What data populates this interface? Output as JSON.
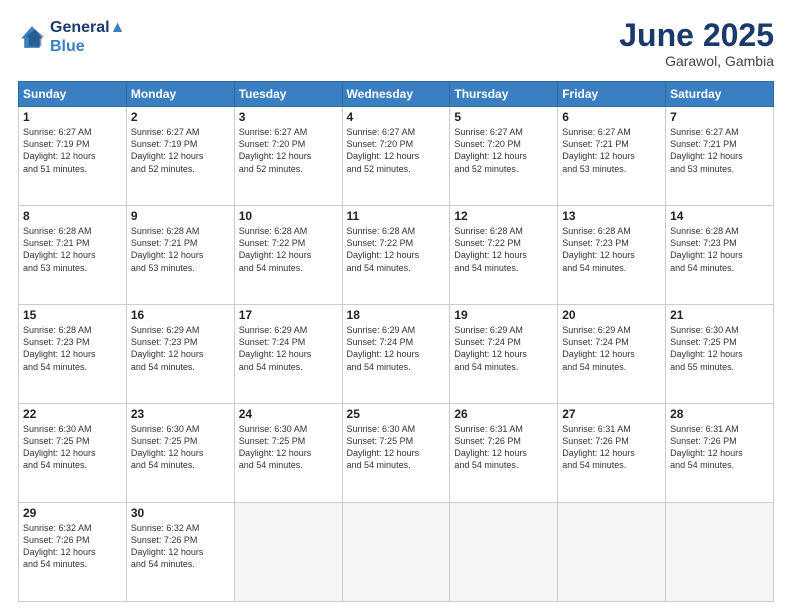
{
  "logo": {
    "line1": "General",
    "line2": "Blue"
  },
  "title": "June 2025",
  "location": "Garawol, Gambia",
  "weekdays": [
    "Sunday",
    "Monday",
    "Tuesday",
    "Wednesday",
    "Thursday",
    "Friday",
    "Saturday"
  ],
  "weeks": [
    [
      {
        "day": "1",
        "detail": "Sunrise: 6:27 AM\nSunset: 7:19 PM\nDaylight: 12 hours\nand 51 minutes."
      },
      {
        "day": "2",
        "detail": "Sunrise: 6:27 AM\nSunset: 7:19 PM\nDaylight: 12 hours\nand 52 minutes."
      },
      {
        "day": "3",
        "detail": "Sunrise: 6:27 AM\nSunset: 7:20 PM\nDaylight: 12 hours\nand 52 minutes."
      },
      {
        "day": "4",
        "detail": "Sunrise: 6:27 AM\nSunset: 7:20 PM\nDaylight: 12 hours\nand 52 minutes."
      },
      {
        "day": "5",
        "detail": "Sunrise: 6:27 AM\nSunset: 7:20 PM\nDaylight: 12 hours\nand 52 minutes."
      },
      {
        "day": "6",
        "detail": "Sunrise: 6:27 AM\nSunset: 7:21 PM\nDaylight: 12 hours\nand 53 minutes."
      },
      {
        "day": "7",
        "detail": "Sunrise: 6:27 AM\nSunset: 7:21 PM\nDaylight: 12 hours\nand 53 minutes."
      }
    ],
    [
      {
        "day": "8",
        "detail": "Sunrise: 6:28 AM\nSunset: 7:21 PM\nDaylight: 12 hours\nand 53 minutes."
      },
      {
        "day": "9",
        "detail": "Sunrise: 6:28 AM\nSunset: 7:21 PM\nDaylight: 12 hours\nand 53 minutes."
      },
      {
        "day": "10",
        "detail": "Sunrise: 6:28 AM\nSunset: 7:22 PM\nDaylight: 12 hours\nand 54 minutes."
      },
      {
        "day": "11",
        "detail": "Sunrise: 6:28 AM\nSunset: 7:22 PM\nDaylight: 12 hours\nand 54 minutes."
      },
      {
        "day": "12",
        "detail": "Sunrise: 6:28 AM\nSunset: 7:22 PM\nDaylight: 12 hours\nand 54 minutes."
      },
      {
        "day": "13",
        "detail": "Sunrise: 6:28 AM\nSunset: 7:23 PM\nDaylight: 12 hours\nand 54 minutes."
      },
      {
        "day": "14",
        "detail": "Sunrise: 6:28 AM\nSunset: 7:23 PM\nDaylight: 12 hours\nand 54 minutes."
      }
    ],
    [
      {
        "day": "15",
        "detail": "Sunrise: 6:28 AM\nSunset: 7:23 PM\nDaylight: 12 hours\nand 54 minutes."
      },
      {
        "day": "16",
        "detail": "Sunrise: 6:29 AM\nSunset: 7:23 PM\nDaylight: 12 hours\nand 54 minutes."
      },
      {
        "day": "17",
        "detail": "Sunrise: 6:29 AM\nSunset: 7:24 PM\nDaylight: 12 hours\nand 54 minutes."
      },
      {
        "day": "18",
        "detail": "Sunrise: 6:29 AM\nSunset: 7:24 PM\nDaylight: 12 hours\nand 54 minutes."
      },
      {
        "day": "19",
        "detail": "Sunrise: 6:29 AM\nSunset: 7:24 PM\nDaylight: 12 hours\nand 54 minutes."
      },
      {
        "day": "20",
        "detail": "Sunrise: 6:29 AM\nSunset: 7:24 PM\nDaylight: 12 hours\nand 54 minutes."
      },
      {
        "day": "21",
        "detail": "Sunrise: 6:30 AM\nSunset: 7:25 PM\nDaylight: 12 hours\nand 55 minutes."
      }
    ],
    [
      {
        "day": "22",
        "detail": "Sunrise: 6:30 AM\nSunset: 7:25 PM\nDaylight: 12 hours\nand 54 minutes."
      },
      {
        "day": "23",
        "detail": "Sunrise: 6:30 AM\nSunset: 7:25 PM\nDaylight: 12 hours\nand 54 minutes."
      },
      {
        "day": "24",
        "detail": "Sunrise: 6:30 AM\nSunset: 7:25 PM\nDaylight: 12 hours\nand 54 minutes."
      },
      {
        "day": "25",
        "detail": "Sunrise: 6:30 AM\nSunset: 7:25 PM\nDaylight: 12 hours\nand 54 minutes."
      },
      {
        "day": "26",
        "detail": "Sunrise: 6:31 AM\nSunset: 7:26 PM\nDaylight: 12 hours\nand 54 minutes."
      },
      {
        "day": "27",
        "detail": "Sunrise: 6:31 AM\nSunset: 7:26 PM\nDaylight: 12 hours\nand 54 minutes."
      },
      {
        "day": "28",
        "detail": "Sunrise: 6:31 AM\nSunset: 7:26 PM\nDaylight: 12 hours\nand 54 minutes."
      }
    ],
    [
      {
        "day": "29",
        "detail": "Sunrise: 6:32 AM\nSunset: 7:26 PM\nDaylight: 12 hours\nand 54 minutes."
      },
      {
        "day": "30",
        "detail": "Sunrise: 6:32 AM\nSunset: 7:26 PM\nDaylight: 12 hours\nand 54 minutes."
      },
      null,
      null,
      null,
      null,
      null
    ]
  ]
}
